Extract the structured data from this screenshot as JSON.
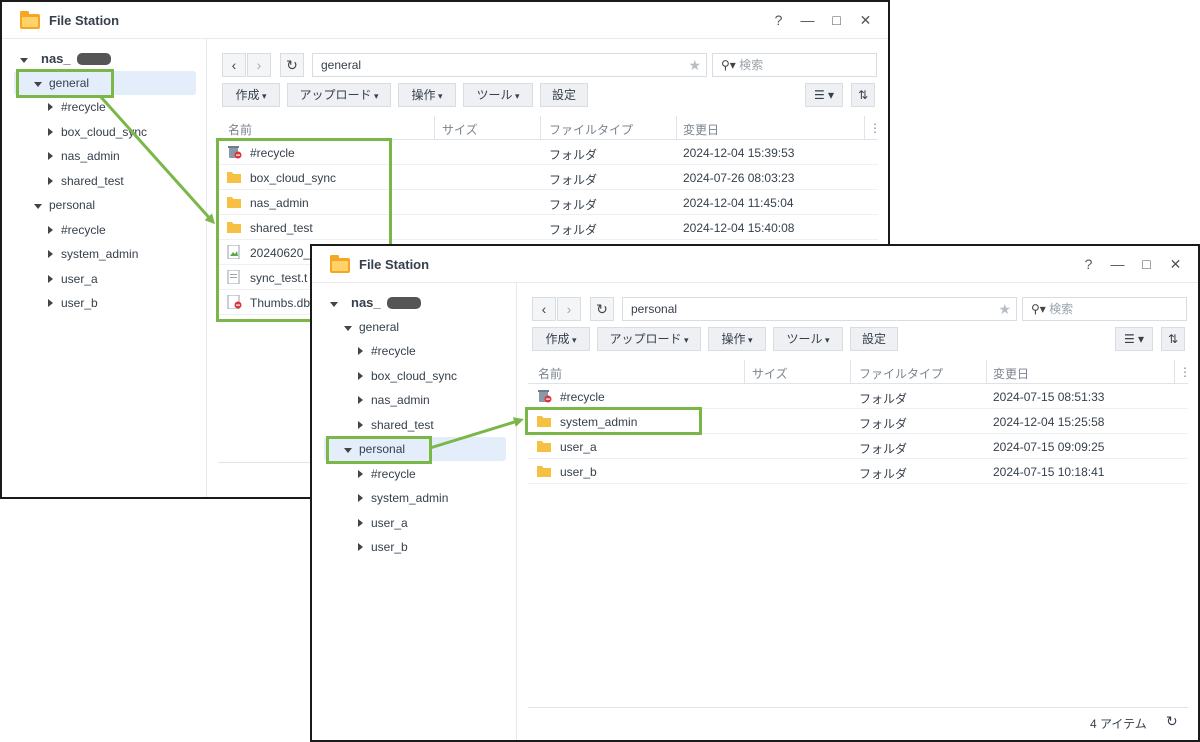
{
  "windows": [
    {
      "title": "File Station",
      "controls": [
        "?",
        "—",
        "□",
        "✕"
      ],
      "tree": {
        "root": "nas_",
        "nodes": [
          {
            "label": "general",
            "level": 1,
            "expanded": true,
            "selected": true
          },
          {
            "label": "#recycle",
            "level": 2
          },
          {
            "label": "box_cloud_sync",
            "level": 2
          },
          {
            "label": "nas_admin",
            "level": 2
          },
          {
            "label": "shared_test",
            "level": 2
          },
          {
            "label": "personal",
            "level": 1,
            "expanded": true
          },
          {
            "label": "#recycle",
            "level": 2
          },
          {
            "label": "system_admin",
            "level": 2
          },
          {
            "label": "user_a",
            "level": 2
          },
          {
            "label": "user_b",
            "level": 2
          }
        ]
      },
      "path": "general",
      "search_placeholder": "検索",
      "toolbar": [
        "作成",
        "アップロード",
        "操作",
        "ツール",
        "設定"
      ],
      "columns": [
        "名前",
        "サイズ",
        "ファイルタイプ",
        "変更日"
      ],
      "rows": [
        {
          "name": "#recycle",
          "type": "フォルダ",
          "date": "2024-12-04 15:39:53",
          "icon": "recycle-folder-icon"
        },
        {
          "name": "box_cloud_sync",
          "type": "フォルダ",
          "date": "2024-07-26 08:03:23",
          "icon": "folder-icon"
        },
        {
          "name": "nas_admin",
          "type": "フォルダ",
          "date": "2024-12-04 11:45:04",
          "icon": "folder-icon"
        },
        {
          "name": "shared_test",
          "type": "フォルダ",
          "date": "2024-12-04 15:40:08",
          "icon": "folder-icon"
        },
        {
          "name": "20240620_",
          "type": "",
          "date": "",
          "icon": "image-file-icon"
        },
        {
          "name": "sync_test.t",
          "type": "",
          "date": "",
          "icon": "text-file-icon"
        },
        {
          "name": "Thumbs.db",
          "type": "",
          "date": "",
          "icon": "db-file-icon"
        }
      ]
    },
    {
      "title": "File Station",
      "controls": [
        "?",
        "—",
        "□",
        "✕"
      ],
      "tree": {
        "root": "nas_",
        "nodes": [
          {
            "label": "general",
            "level": 1,
            "expanded": true
          },
          {
            "label": "#recycle",
            "level": 2
          },
          {
            "label": "box_cloud_sync",
            "level": 2
          },
          {
            "label": "nas_admin",
            "level": 2
          },
          {
            "label": "shared_test",
            "level": 2
          },
          {
            "label": "personal",
            "level": 1,
            "expanded": true,
            "selected": true
          },
          {
            "label": "#recycle",
            "level": 2
          },
          {
            "label": "system_admin",
            "level": 2
          },
          {
            "label": "user_a",
            "level": 2
          },
          {
            "label": "user_b",
            "level": 2
          }
        ]
      },
      "path": "personal",
      "search_placeholder": "検索",
      "toolbar": [
        "作成",
        "アップロード",
        "操作",
        "ツール",
        "設定"
      ],
      "columns": [
        "名前",
        "サイズ",
        "ファイルタイプ",
        "変更日"
      ],
      "rows": [
        {
          "name": "#recycle",
          "type": "フォルダ",
          "date": "2024-07-15 08:51:33",
          "icon": "recycle-folder-icon"
        },
        {
          "name": "system_admin",
          "type": "フォルダ",
          "date": "2024-12-04 15:25:58",
          "icon": "folder-icon"
        },
        {
          "name": "user_a",
          "type": "フォルダ",
          "date": "2024-07-15 09:09:25",
          "icon": "folder-icon"
        },
        {
          "name": "user_b",
          "type": "フォルダ",
          "date": "2024-07-15 10:18:41",
          "icon": "folder-icon"
        }
      ],
      "footer": "4 アイテム"
    }
  ],
  "colors": {
    "highlight": "#7ab648",
    "selection": "#e4eefa",
    "folder": "#f6c143"
  }
}
